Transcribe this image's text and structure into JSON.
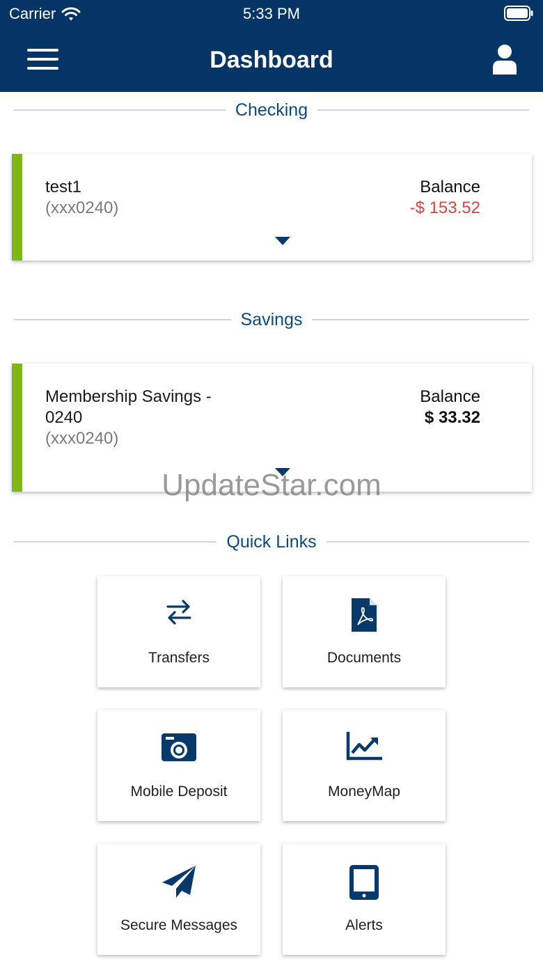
{
  "status_bar": {
    "carrier": "Carrier",
    "time": "5:33 PM"
  },
  "header": {
    "title": "Dashboard"
  },
  "sections": {
    "checking": "Checking",
    "savings": "Savings",
    "quick_links": "Quick Links"
  },
  "checking_account": {
    "name": "test1",
    "number": "(xxx0240)",
    "balance_label": "Balance",
    "balance": "-$ 153.52"
  },
  "savings_account": {
    "name_line1": "Membership Savings -",
    "name_line2": "0240",
    "number": "(xxx0240)",
    "balance_label": "Balance",
    "balance": "$ 33.32"
  },
  "quick_links": {
    "transfers": "Transfers",
    "documents": "Documents",
    "mobile_deposit": "Mobile Deposit",
    "moneymap": "MoneyMap",
    "secure_messages": "Secure Messages",
    "alerts": "Alerts"
  },
  "watermark": "UpdateStar.com",
  "colors": {
    "header_bg": "#053566",
    "accent_green": "#7fb80e",
    "negative": "#d94545",
    "section_text": "#0b4a80",
    "icon": "#073a6a"
  }
}
